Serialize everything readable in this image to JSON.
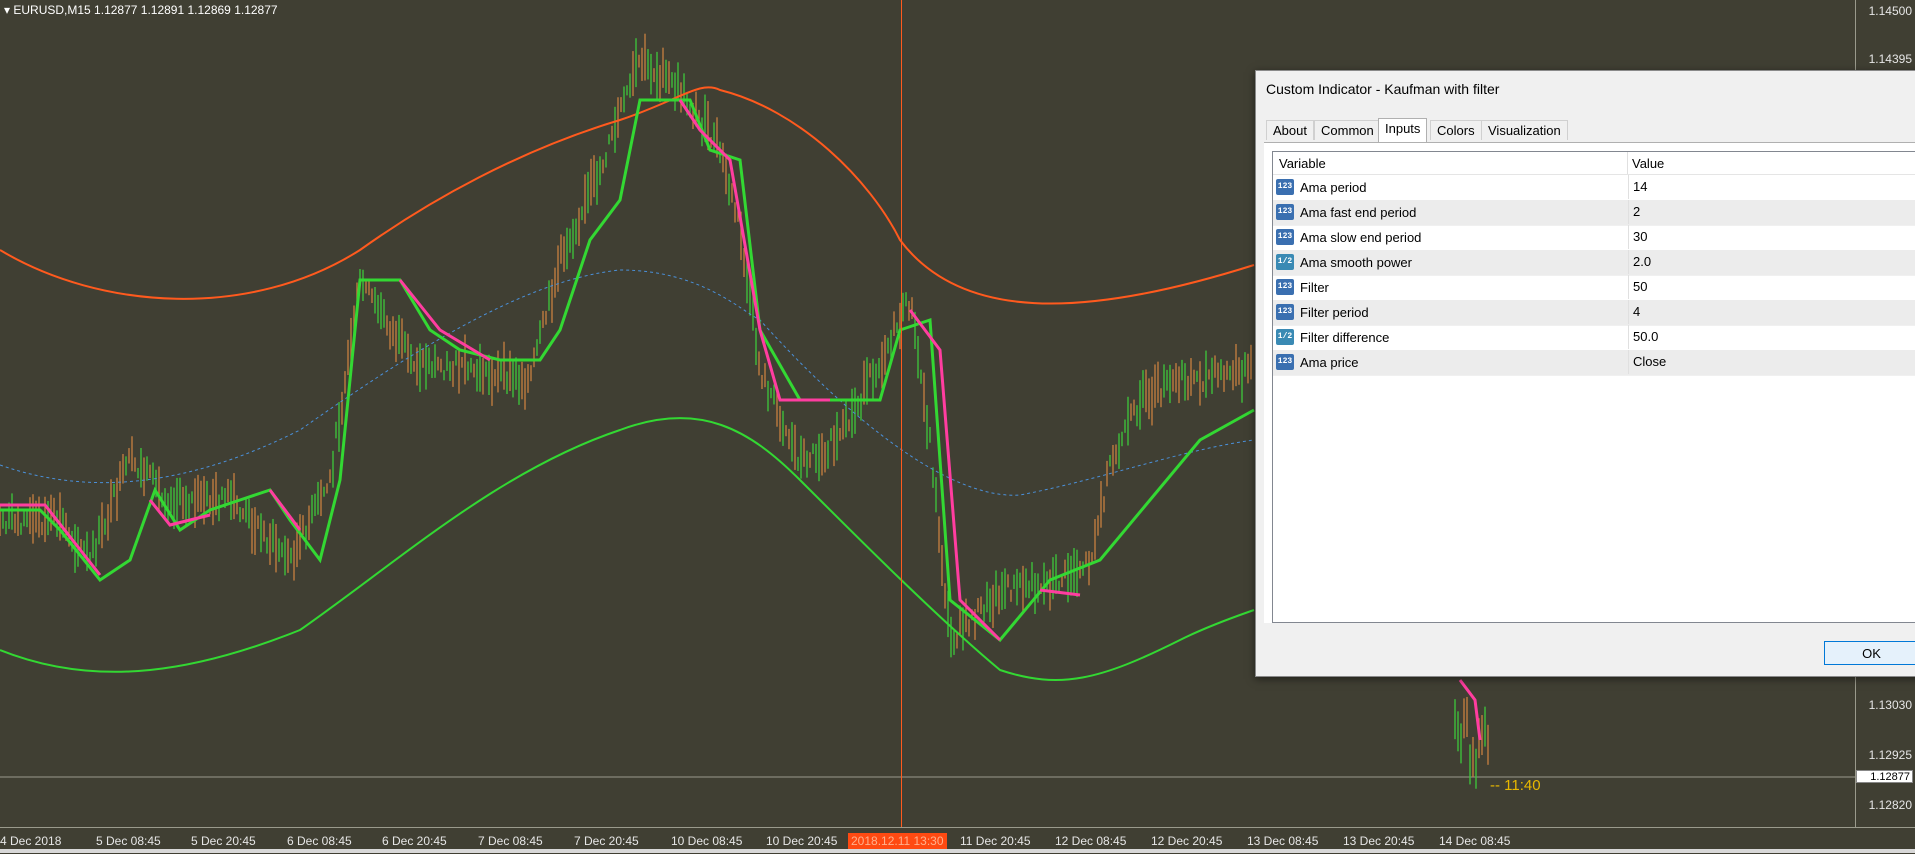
{
  "window": {
    "symbol_title": "EURUSD,M15  1.12877 1.12891 1.12869 1.12877"
  },
  "price_axis": {
    "ticks": [
      "1.14500",
      "1.14395",
      "1.13030",
      "1.12925",
      "1.12820"
    ],
    "current_price": "1.12877"
  },
  "time_axis": {
    "ticks": [
      "4 Dec 2018",
      "5 Dec 08:45",
      "5 Dec 20:45",
      "6 Dec 08:45",
      "6 Dec 20:45",
      "7 Dec 08:45",
      "7 Dec 20:45",
      "10 Dec 08:45",
      "10 Dec 20:45",
      "11 Dec 20:45",
      "12 Dec 08:45",
      "12 Dec 20:45",
      "13 Dec 08:45",
      "13 Dec 20:45",
      "14 Dec 08:45"
    ],
    "highlight": "2018.12.11 13:30"
  },
  "countdown": "-- 11:40",
  "colors": {
    "background": "#403f33",
    "candle_up": "#3cc83c",
    "candle_down": "#c88040",
    "ama_up": "#33d833",
    "ama_down": "#ff3da0",
    "upper_band": "#ff5a1e",
    "lower_band": "#33d833",
    "mid_band": "#4a90d9",
    "crosshair": "#ff5a1e"
  },
  "dialog": {
    "title": "Custom Indicator - Kaufman with filter",
    "tabs": [
      "About",
      "Common",
      "Inputs",
      "Colors",
      "Visualization"
    ],
    "active_tab": "Inputs",
    "columns": {
      "variable": "Variable",
      "value": "Value"
    },
    "params": [
      {
        "icon": "123",
        "name": "Ama period",
        "value": "14"
      },
      {
        "icon": "123",
        "name": "Ama fast end period",
        "value": "2"
      },
      {
        "icon": "123",
        "name": "Ama slow end period",
        "value": "30"
      },
      {
        "icon": "1/2",
        "name": "Ama smooth power",
        "value": "2.0"
      },
      {
        "icon": "123",
        "name": "Filter",
        "value": "50"
      },
      {
        "icon": "123",
        "name": "Filter period",
        "value": "4"
      },
      {
        "icon": "1/2",
        "name": "Filter difference",
        "value": "50.0"
      },
      {
        "icon": "123",
        "name": "Ama price",
        "value": "Close"
      }
    ],
    "ok_label": "OK"
  }
}
